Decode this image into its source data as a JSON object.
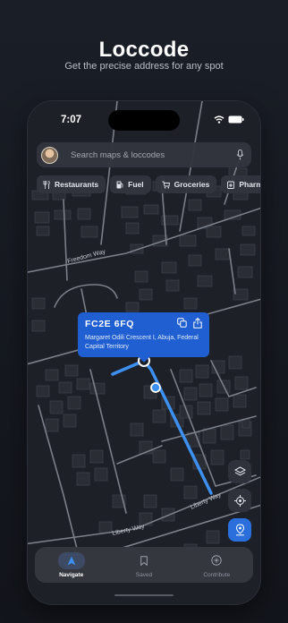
{
  "hero": {
    "title": "Loccode",
    "subtitle": "Get the precise address for any spot"
  },
  "status_bar": {
    "time": "7:07"
  },
  "search": {
    "placeholder": "Search maps & loccodes"
  },
  "categories": [
    {
      "label": "Restaurants",
      "icon": "fork-knife-icon"
    },
    {
      "label": "Fuel",
      "icon": "fuel-pump-icon"
    },
    {
      "label": "Groceries",
      "icon": "cart-icon"
    },
    {
      "label": "Pharm",
      "icon": "pharmacy-icon"
    }
  ],
  "map": {
    "roads": [
      "Freedom Way",
      "Liberty Way",
      "Liberty Way"
    ],
    "route_color": "#3d8ff0"
  },
  "callout": {
    "code": "FC2E 6FQ",
    "address": "Margaret Odili Crescent I, Abuja, Federal Capital Territory",
    "background": "#1f5fd1"
  },
  "tabs": [
    {
      "label": "Navigate",
      "icon": "navigate-arrow-icon",
      "active": true
    },
    {
      "label": "Saved",
      "icon": "bookmark-icon",
      "active": false
    },
    {
      "label": "Contribute",
      "icon": "plus-circle-icon",
      "active": false
    }
  ]
}
